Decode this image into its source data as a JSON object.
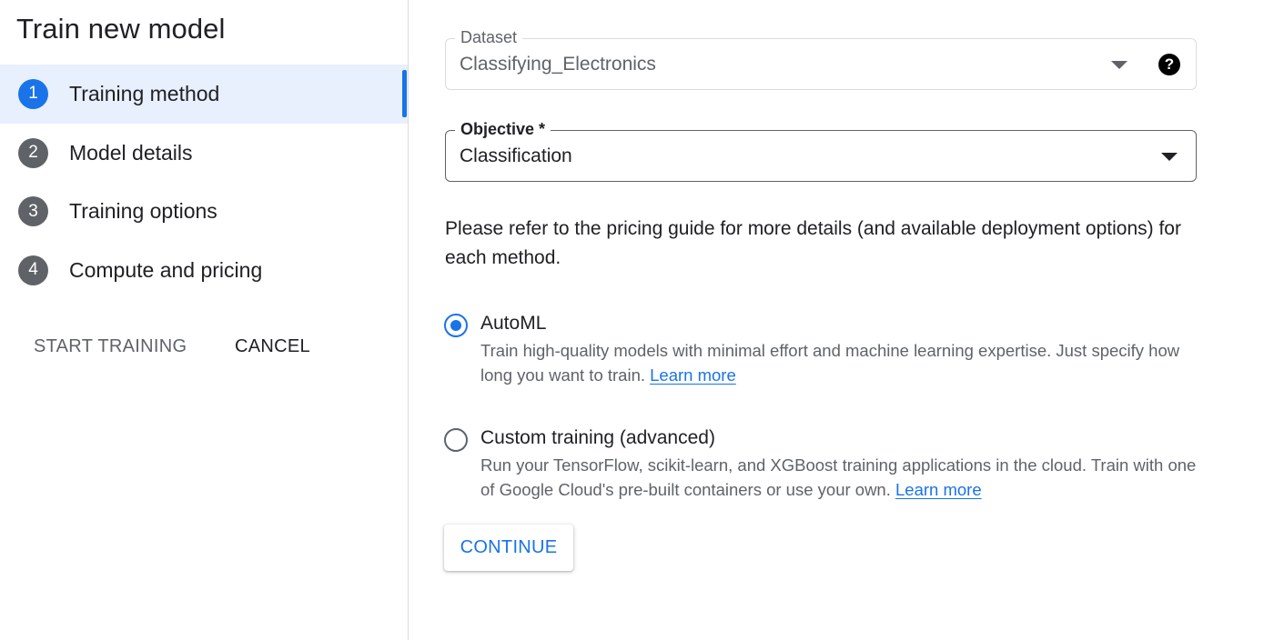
{
  "page": {
    "title": "Train new model"
  },
  "steps": [
    {
      "number": "1",
      "label": "Training method",
      "active": true
    },
    {
      "number": "2",
      "label": "Model details",
      "active": false
    },
    {
      "number": "3",
      "label": "Training options",
      "active": false
    },
    {
      "number": "4",
      "label": "Compute and pricing",
      "active": false
    }
  ],
  "actions": {
    "start_label": "START TRAINING",
    "cancel_label": "CANCEL"
  },
  "dataset": {
    "label": "Dataset",
    "value": "Classifying_Electronics",
    "help_icon": "help-icon"
  },
  "objective": {
    "label": "Objective *",
    "value": "Classification"
  },
  "info": "Please refer to the pricing guide for more details (and available deployment options) for each method.",
  "methods": {
    "automl": {
      "title": "AutoML",
      "description": "Train high-quality models with minimal effort and machine learning expertise. Just specify how long you want to train.",
      "link": "Learn more",
      "selected": true
    },
    "custom": {
      "title": "Custom training (advanced)",
      "description": "Run your TensorFlow, scikit-learn, and XGBoost training applications in the cloud. Train with one of Google Cloud's pre-built containers or use your own.",
      "link": "Learn more",
      "selected": false
    }
  },
  "continue_label": "CONTINUE",
  "colors": {
    "accent": "#1a73e8",
    "active_step_bg": "#e8f0fe",
    "inactive_step": "#5f6368"
  }
}
